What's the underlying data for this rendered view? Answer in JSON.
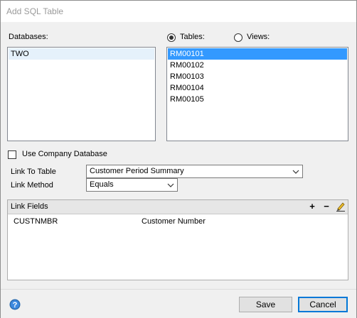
{
  "window": {
    "title": "Add SQL Table"
  },
  "databases": {
    "label": "Databases:",
    "items": [
      "TWO"
    ]
  },
  "source_type": {
    "tables_label": "Tables:",
    "views_label": "Views:",
    "selected": "Tables"
  },
  "tables": {
    "items": [
      "RM00101",
      "RM00102",
      "RM00103",
      "RM00104",
      "RM00105"
    ],
    "selected_index": 0
  },
  "use_company_db": {
    "label": "Use Company Database",
    "checked": false
  },
  "link_to_table": {
    "label": "Link To Table",
    "value": "Customer Period Summary"
  },
  "link_method": {
    "label": "Link Method",
    "value": "Equals"
  },
  "link_fields": {
    "title": "Link Fields",
    "add_label": "+",
    "remove_label": "−",
    "rows": [
      {
        "field": "CUSTNMBR",
        "description": "Customer Number"
      }
    ]
  },
  "buttons": {
    "save": "Save",
    "cancel": "Cancel"
  },
  "icons": {
    "help": "help-icon",
    "edit": "pencil-icon",
    "dropdown": "chevron-down-icon"
  },
  "colors": {
    "selection": "#3399ff",
    "default_button_border": "#0078d7",
    "help_icon": "#2b6cb0"
  }
}
